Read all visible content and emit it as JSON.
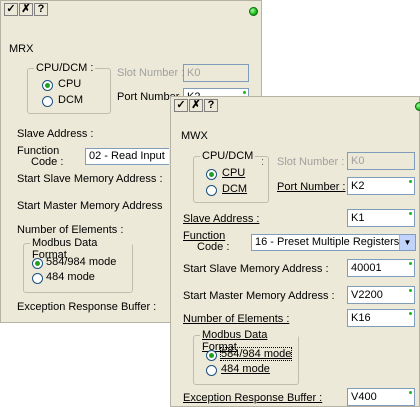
{
  "title_icons": [
    "✓",
    "✗",
    "?"
  ],
  "accent_colors": {
    "status_led": "#19b919",
    "dialog_bg": "#ece9d8",
    "input_border": "#7f9db9"
  },
  "back": {
    "title": "MRX",
    "cpu_group": {
      "title": "CPU/DCM :",
      "option_cpu": "CPU",
      "option_dcm": "DCM"
    },
    "slot_number": {
      "label": "Slot Number :",
      "value": "K0"
    },
    "port_number": {
      "label": "Port Number :",
      "value": "K2"
    },
    "slave_address": {
      "label": "Slave Address :"
    },
    "function": {
      "label_line1": "Function",
      "label_line2": "Code :",
      "value": "02 - Read Input"
    },
    "start_slave": {
      "label": "Start Slave Memory Address :"
    },
    "start_master": {
      "label": "Start Master Memory Address"
    },
    "num_elements": {
      "label": "Number of Elements :"
    },
    "modbus": {
      "title": "Modbus Data Format",
      "opt1": "584/984 mode",
      "opt2": "484 mode"
    },
    "exception": {
      "label": "Exception Response Buffer :"
    }
  },
  "front": {
    "title": "MWX",
    "cpu_group": {
      "title": "CPU/DCM",
      "option_cpu": "CPU",
      "option_dcm": "DCM"
    },
    "slot_number": {
      "label": "Slot Number :",
      "value": "K0"
    },
    "port_number": {
      "label": "Port Number :",
      "value": "K2"
    },
    "slave_address": {
      "label": "Slave Address :",
      "value": "K1"
    },
    "function": {
      "label_line1": "Function",
      "label_line2": "Code :",
      "value": "16 - Preset Multiple Registers"
    },
    "start_slave": {
      "label": "Start Slave Memory Address :",
      "value": "40001"
    },
    "start_master": {
      "label": "Start Master Memory Address :",
      "value": "V2200"
    },
    "num_elements": {
      "label": "Number of Elements :",
      "value": "K16"
    },
    "modbus": {
      "title": "Modbus Data Format",
      "opt1": "584/984 mode",
      "opt2": "484 mode"
    },
    "exception": {
      "label": "Exception Response Buffer :",
      "value": "V400"
    }
  }
}
